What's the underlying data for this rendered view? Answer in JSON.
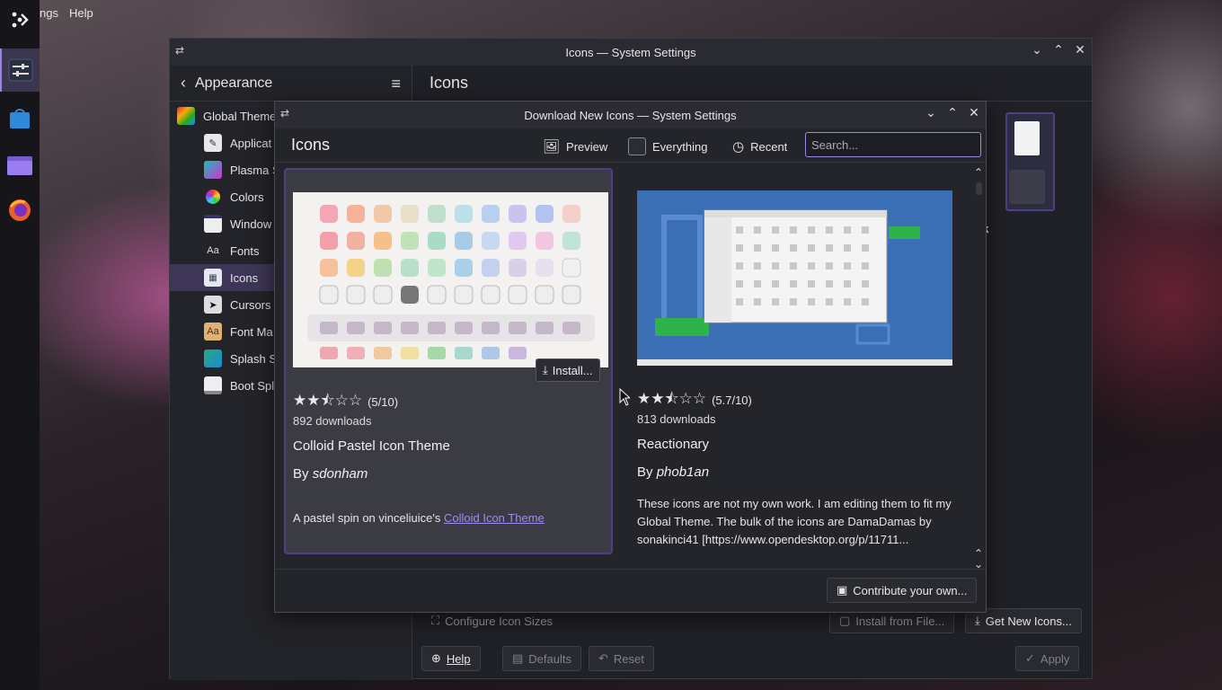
{
  "menubar": {
    "items": [
      "ngs",
      "Help"
    ]
  },
  "main_window": {
    "title": "Icons — System Settings",
    "sidebar_header": "Appearance",
    "content_title": "Icons",
    "nav": [
      {
        "label": "Global Theme",
        "level": 0
      },
      {
        "label": "Applicat",
        "level": 1
      },
      {
        "label": "Plasma S",
        "level": 1
      },
      {
        "label": "Colors",
        "level": 1
      },
      {
        "label": "Window",
        "level": 1
      },
      {
        "label": "Fonts",
        "level": 1
      },
      {
        "label": "Icons",
        "level": 1,
        "selected": true
      },
      {
        "label": "Cursors",
        "level": 1
      },
      {
        "label": "Font Ma",
        "level": 1
      },
      {
        "label": "Splash S",
        "level": 1
      },
      {
        "label": "Boot Spl",
        "level": 1
      }
    ],
    "theme_caption": "ark",
    "buttons": {
      "configure_sizes": "Configure Icon Sizes",
      "install_from_file": "Install from File...",
      "get_new_icons": "Get New Icons...",
      "help": "Help",
      "defaults": "Defaults",
      "reset": "Reset",
      "apply": "Apply"
    }
  },
  "dialog": {
    "title": "Download New Icons — System Settings",
    "heading": "Icons",
    "toolbar": {
      "preview": "Preview",
      "everything": "Everything",
      "recent": "Recent",
      "search_placeholder": "Search..."
    },
    "items": [
      {
        "rating_text": "(5/10)",
        "rating_value": 5,
        "downloads": "892 downloads",
        "name": "Colloid Pastel Icon Theme",
        "by": "By",
        "author": "sdonham",
        "description": "A pastel spin on vinceliuice's",
        "description_link": "Colloid Icon Theme",
        "install_label": "Install..."
      },
      {
        "rating_text": "(5.7/10)",
        "rating_value": 5.7,
        "downloads": "813 downloads",
        "name": "Reactionary",
        "by": "By",
        "author": "phob1an",
        "description": "These icons are not my own work. I am editing them to fit my Global Theme. The bulk of the icons are DamaDamas by sonakinci41 [https://www.opendesktop.org/p/11711..."
      }
    ],
    "footer": {
      "contribute": "Contribute your own..."
    }
  },
  "colors": {
    "accent": "#9d87e3",
    "selection": "#3e3656",
    "window_bg": "#202127"
  }
}
